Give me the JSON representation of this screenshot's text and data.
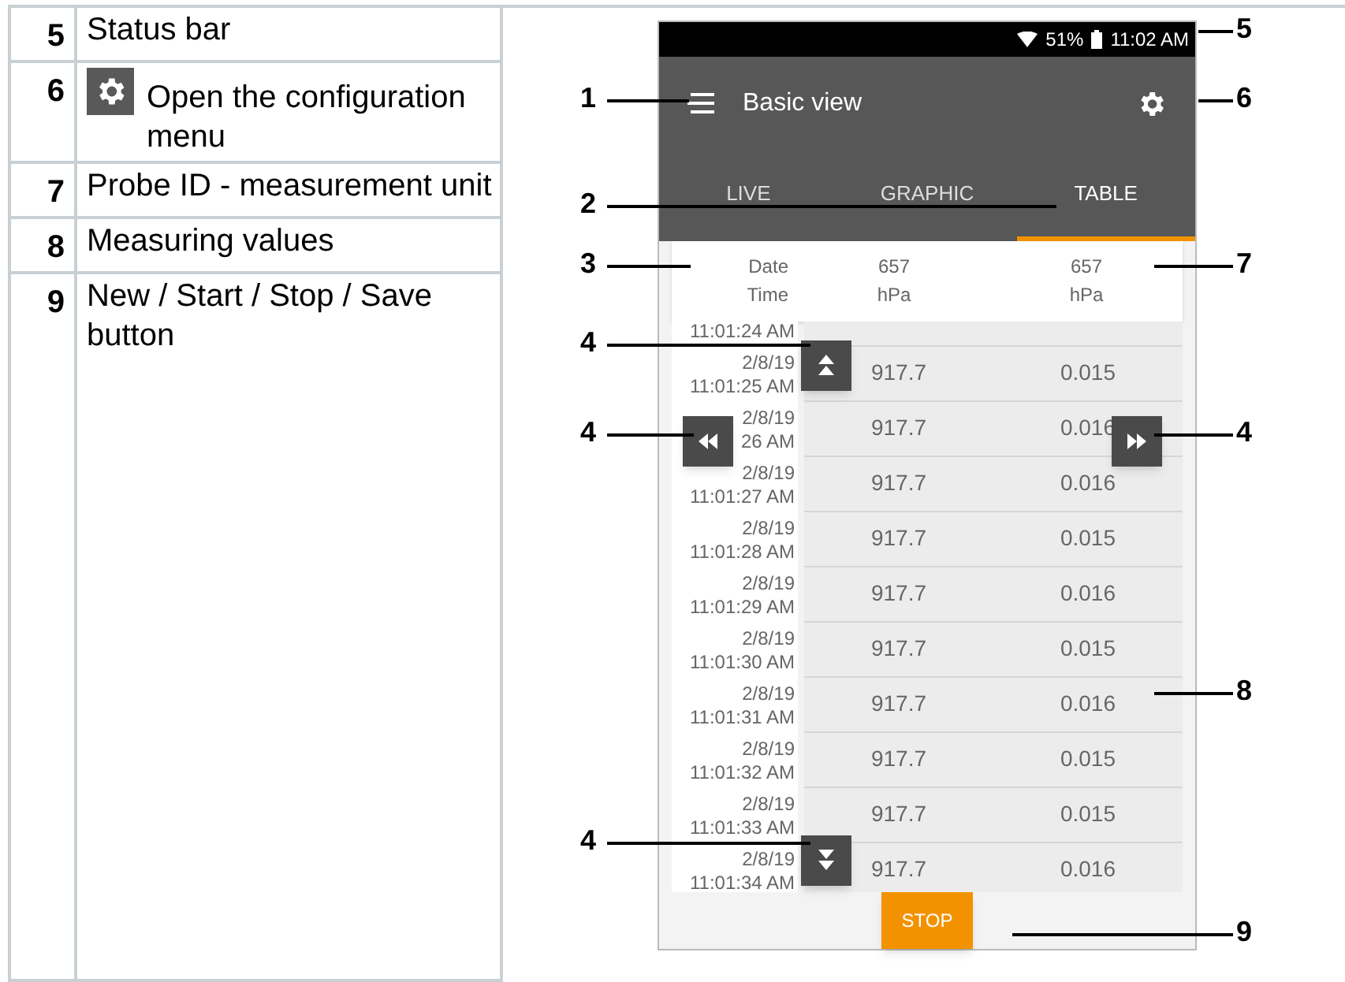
{
  "legend": [
    {
      "number": "5",
      "kind": "text",
      "text": "Status bar"
    },
    {
      "number": "6",
      "kind": "gear",
      "text": "Open the configuration menu"
    },
    {
      "number": "7",
      "kind": "text",
      "text": "Probe ID - measurement unit"
    },
    {
      "number": "8",
      "kind": "text",
      "text": "Measuring values"
    },
    {
      "number": "9",
      "kind": "text",
      "text": "New / Start / Stop / Save button"
    }
  ],
  "screen": {
    "status_bar": {
      "battery": "51%",
      "time": "11:02 AM"
    },
    "app_bar": {
      "title": "Basic view"
    },
    "tabs": [
      {
        "label": "LIVE",
        "selected": false
      },
      {
        "label": "GRAPHIC",
        "selected": false
      },
      {
        "label": "TABLE",
        "selected": true
      }
    ],
    "table": {
      "columns": [
        {
          "line1": "Date",
          "line2": "Time"
        },
        {
          "line1": "657",
          "line2": "hPa"
        },
        {
          "line1": "657",
          "line2": "hPa"
        }
      ],
      "rows": [
        {
          "time": "11:01:24 AM"
        },
        {
          "date": "2/8/19",
          "time": "11:01:25 AM",
          "values": [
            "917.7",
            "0.015"
          ]
        },
        {
          "date": "2/8/19",
          "time": "26 AM",
          "values": [
            "917.7",
            "0.016"
          ]
        },
        {
          "date": "2/8/19",
          "time": "11:01:27 AM",
          "values": [
            "917.7",
            "0.016"
          ]
        },
        {
          "date": "2/8/19",
          "time": "11:01:28 AM",
          "values": [
            "917.7",
            "0.015"
          ]
        },
        {
          "date": "2/8/19",
          "time": "11:01:29 AM",
          "values": [
            "917.7",
            "0.016"
          ]
        },
        {
          "date": "2/8/19",
          "time": "11:01:30 AM",
          "values": [
            "917.7",
            "0.015"
          ]
        },
        {
          "date": "2/8/19",
          "time": "11:01:31 AM",
          "values": [
            "917.7",
            "0.016"
          ]
        },
        {
          "date": "2/8/19",
          "time": "11:01:32 AM",
          "values": [
            "917.7",
            "0.015"
          ]
        },
        {
          "date": "2/8/19",
          "time": "11:01:33 AM",
          "values": [
            "917.7",
            "0.015"
          ]
        },
        {
          "date": "2/8/19",
          "time": "11:01:34 AM",
          "values": [
            "917.7",
            "0.016"
          ]
        }
      ]
    },
    "button": "STOP"
  },
  "callouts": [
    {
      "label": "5"
    },
    {
      "label": "1"
    },
    {
      "label": "6"
    },
    {
      "label": "2"
    },
    {
      "label": "3"
    },
    {
      "label": "7"
    },
    {
      "label": "4"
    },
    {
      "label": "4"
    },
    {
      "label": "4"
    },
    {
      "label": "8"
    },
    {
      "label": "4"
    },
    {
      "label": "9"
    }
  ]
}
